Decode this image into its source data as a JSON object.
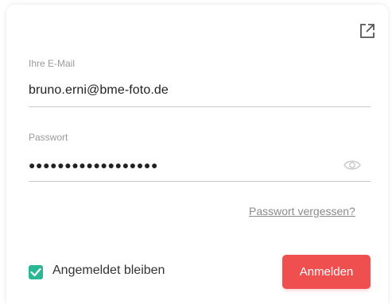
{
  "login": {
    "email_label": "Ihre E-Mail",
    "email_value": "bruno.erni@bme-foto.de",
    "password_label": "Passwort",
    "password_masked": "●●●●●●●●●●●●●●●●●●",
    "forgot_link": "Passwort vergessen?",
    "remember_label": "Angemeldet bleiben",
    "remember_checked": true,
    "login_button": "Anmelden"
  },
  "icons": {
    "open_external": "open-external-icon",
    "show_password": "eye-icon",
    "checkbox": "checkmark-icon"
  },
  "colors": {
    "accent_button": "#ef4f4f",
    "checkbox": "#2ab894",
    "label": "#9a9a9a",
    "text": "#222222",
    "divider": "#c9c9c9"
  }
}
